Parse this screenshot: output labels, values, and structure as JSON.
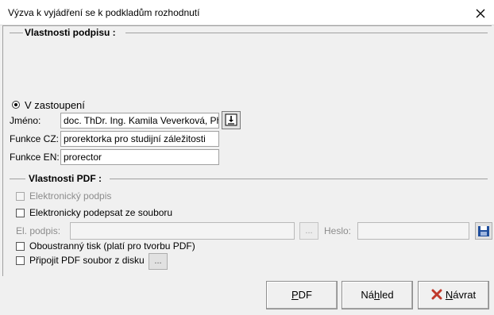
{
  "window": {
    "title": "Výzva k vyjádření se k podkladům rozhodnutí"
  },
  "signature_section": {
    "legend": "Vlastnosti podpisu :",
    "radio_label": "V zastoupení",
    "name_label": "Jméno:",
    "name_value": "doc. ThDr. Ing. Kamila Veverková, Ph",
    "func_cz_label": "Funkce CZ:",
    "func_cz_value": "prorektorka pro studijní záležitosti",
    "func_en_label": "Funkce EN:",
    "func_en_value": "prorector"
  },
  "pdf_section": {
    "legend": "Vlastnosti PDF :",
    "electronic_sign_label": "Elektronický podpis",
    "sign_from_file_label": "Elektronicky podepsat ze souboru",
    "el_sign_label": "El. podpis:",
    "el_sign_value": "",
    "browse_label": "...",
    "password_label": "Heslo:",
    "password_value": "",
    "duplex_label": "Oboustranný tisk (platí pro tvorbu PDF)",
    "attach_pdf_label": "Připojit PDF soubor z disku",
    "attach_browse_label": "..."
  },
  "buttons": {
    "pdf_underline": "P",
    "pdf_rest": "DF",
    "preview_pre": "Ná",
    "preview_underline": "h",
    "preview_rest": "led",
    "back_underline": "N",
    "back_rest": "ávrat"
  },
  "colors": {
    "cancel_icon": "#c0392b",
    "save_icon": "#1f4e9c"
  }
}
